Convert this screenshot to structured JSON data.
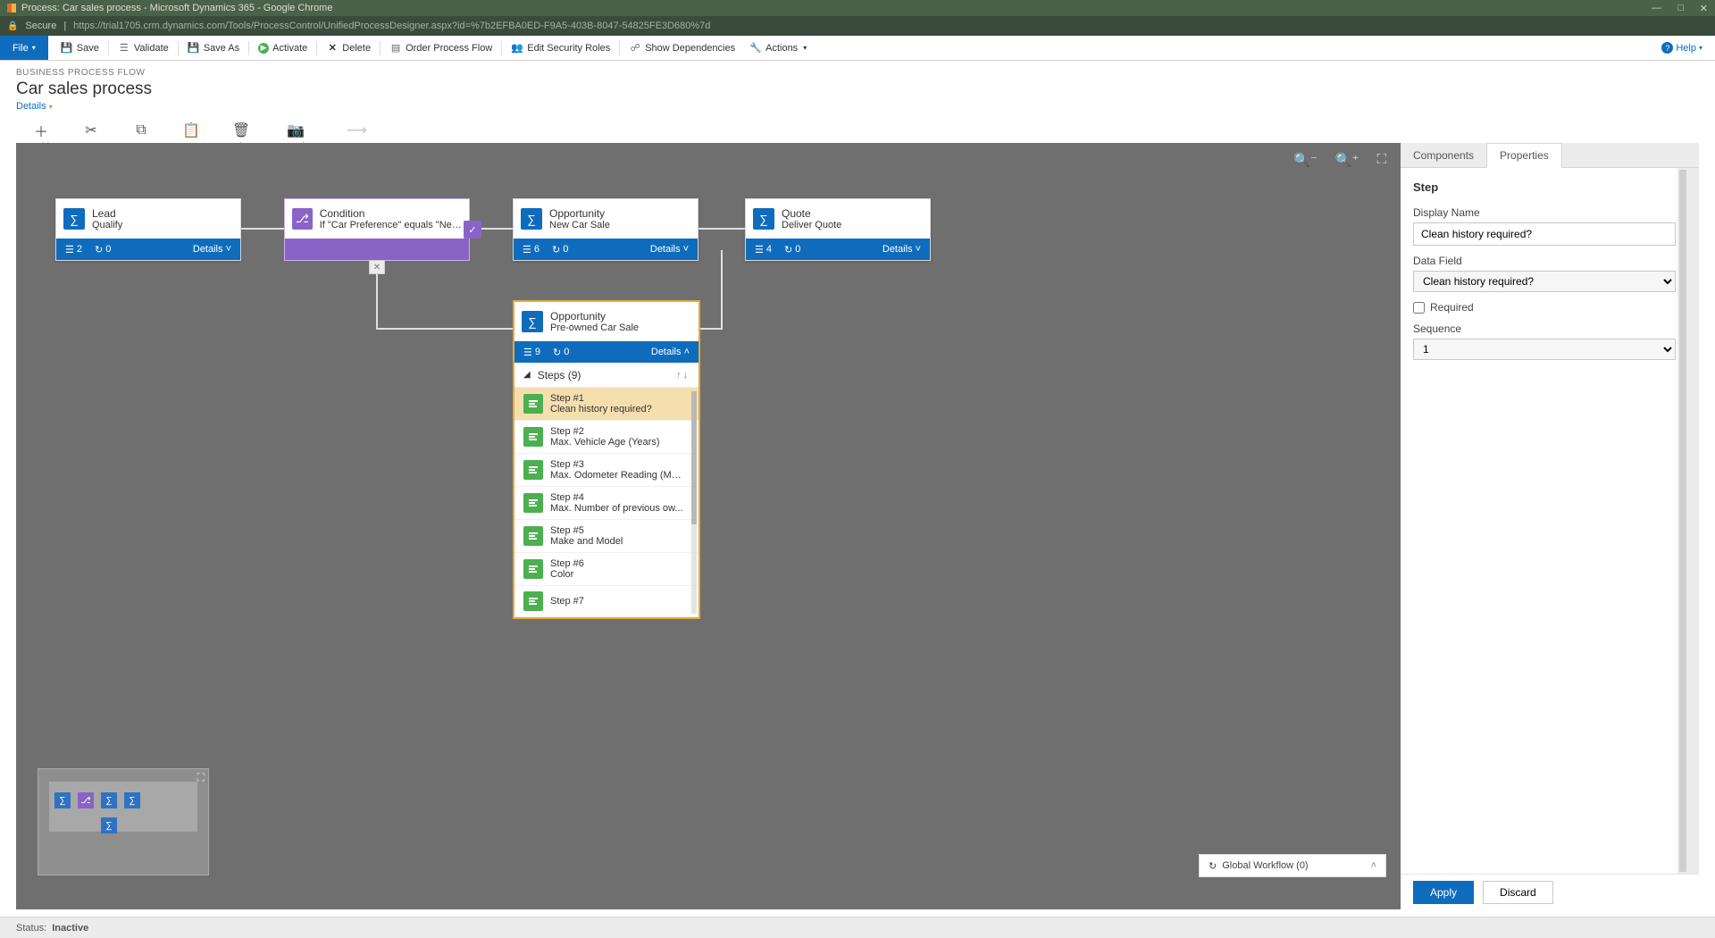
{
  "window": {
    "title": "Process: Car sales process - Microsoft Dynamics 365 - Google Chrome",
    "secure_label": "Secure",
    "url": "https://trial1705.crm.dynamics.com/Tools/ProcessControl/UnifiedProcessDesigner.aspx?id=%7b2EFBA0ED-F9A5-403B-8047-54825FE3D680%7d"
  },
  "ribbon": {
    "file": "File",
    "save": "Save",
    "validate": "Validate",
    "save_as": "Save As",
    "activate": "Activate",
    "delete": "Delete",
    "order": "Order Process Flow",
    "security": "Edit Security Roles",
    "deps": "Show Dependencies",
    "actions": "Actions",
    "help": "Help"
  },
  "header": {
    "eyebrow": "BUSINESS PROCESS FLOW",
    "name": "Car sales process",
    "details": "Details"
  },
  "toolbar": {
    "add": "Add",
    "cut": "Cut",
    "copy": "Copy",
    "paste": "Paste",
    "delete": "Delete",
    "snapshot": "Snapshot",
    "connector": "Connector"
  },
  "stages": {
    "lead": {
      "entity": "Lead",
      "name": "Qualify",
      "count": "2",
      "wf": "0",
      "details": "Details"
    },
    "condition": {
      "title": "Condition",
      "sub": "If \"Car Preference\" equals \"New ..."
    },
    "opp_new": {
      "entity": "Opportunity",
      "name": "New Car Sale",
      "count": "6",
      "wf": "0",
      "details": "Details"
    },
    "quote": {
      "entity": "Quote",
      "name": "Deliver Quote",
      "count": "4",
      "wf": "0",
      "details": "Details"
    },
    "opp_pre": {
      "entity": "Opportunity",
      "name": "Pre-owned Car Sale",
      "count": "9",
      "wf": "0",
      "details": "Details"
    }
  },
  "steps_header": "Steps (9)",
  "steps": [
    {
      "t": "Step #1",
      "s": "Clean history required?",
      "sel": true
    },
    {
      "t": "Step #2",
      "s": "Max. Vehicle Age (Years)"
    },
    {
      "t": "Step #3",
      "s": "Max. Odometer Reading (Max)"
    },
    {
      "t": "Step #4",
      "s": "Max. Number of previous ow..."
    },
    {
      "t": "Step #5",
      "s": "Make and Model"
    },
    {
      "t": "Step #6",
      "s": "Color"
    },
    {
      "t": "Step #7",
      "s": ""
    }
  ],
  "global_wf": "Global Workflow (0)",
  "side": {
    "tab_components": "Components",
    "tab_properties": "Properties",
    "section": "Step",
    "display_name_label": "Display Name",
    "display_name_value": "Clean history required?",
    "data_field_label": "Data Field",
    "data_field_value": "Clean history required?",
    "required_label": "Required",
    "sequence_label": "Sequence",
    "sequence_value": "1",
    "apply": "Apply",
    "discard": "Discard"
  },
  "status": {
    "label": "Status:",
    "value": "Inactive"
  }
}
